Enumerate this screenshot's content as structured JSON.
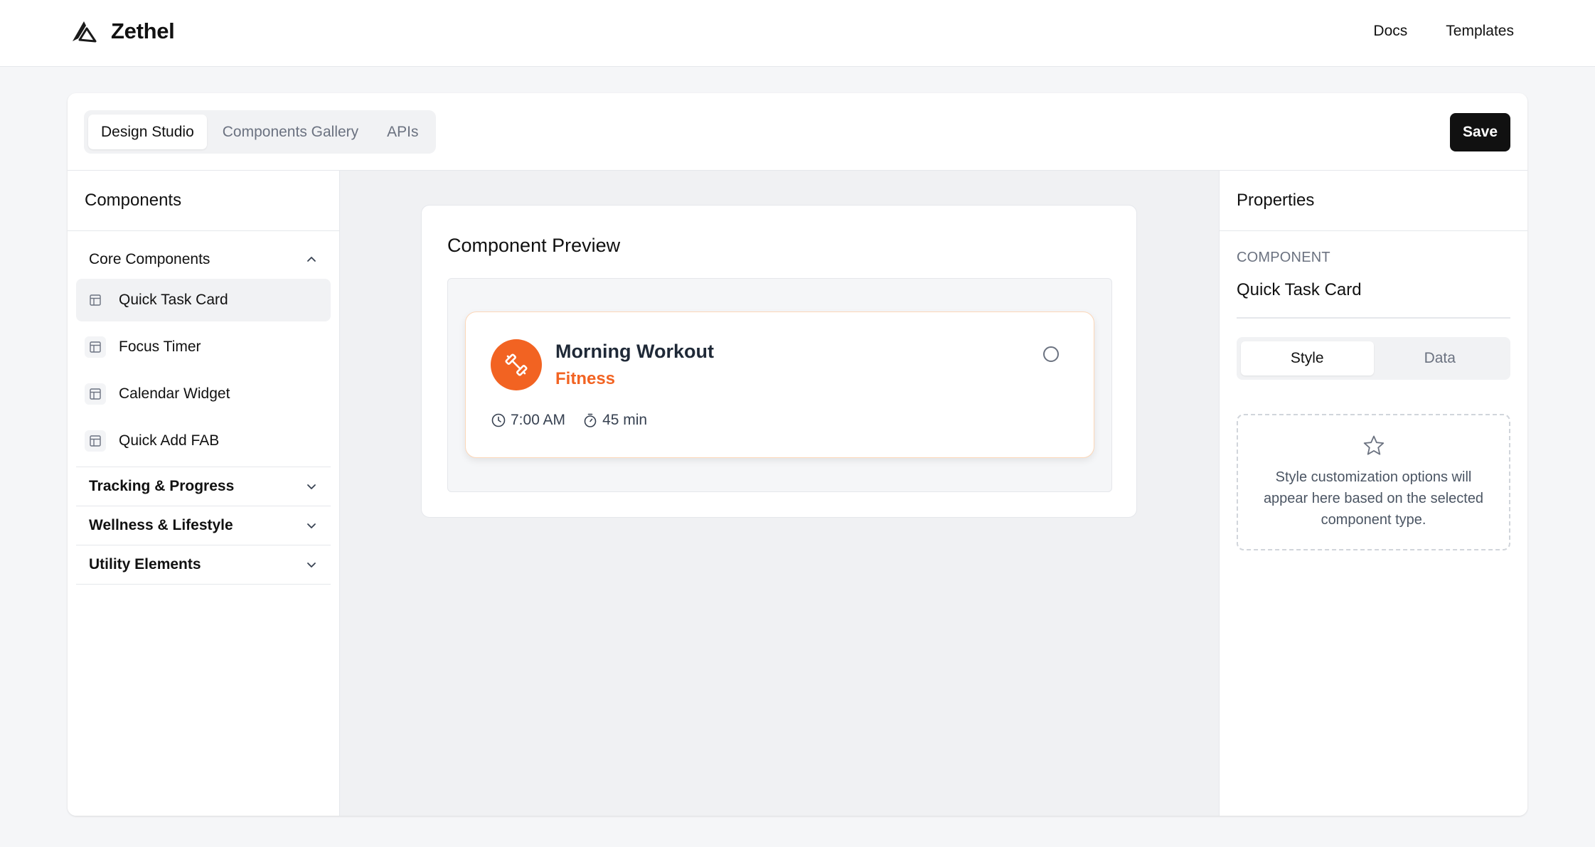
{
  "app": {
    "brand": "Zethel"
  },
  "nav": {
    "docs": "Docs",
    "templates": "Templates"
  },
  "tabs": [
    {
      "label": "Design Studio",
      "active": true
    },
    {
      "label": "Components Gallery",
      "active": false
    },
    {
      "label": "APIs",
      "active": false
    }
  ],
  "toolbar": {
    "save_label": "Save"
  },
  "sidebar": {
    "title": "Components",
    "groups": [
      {
        "label": "Core Components",
        "expanded": true,
        "items": [
          "Quick Task Card",
          "Focus Timer",
          "Calendar Widget",
          "Quick Add FAB"
        ],
        "selected": "Quick Task Card"
      },
      {
        "label": "Tracking & Progress",
        "expanded": false
      },
      {
        "label": "Wellness & Lifestyle",
        "expanded": false
      },
      {
        "label": "Utility Elements",
        "expanded": false
      }
    ]
  },
  "preview": {
    "title": "Component Preview",
    "card": {
      "title": "Morning Workout",
      "category": "Fitness",
      "time": "7:00 AM",
      "duration": "45 min",
      "accent_color": "#f26322",
      "icon": "dumbbell-icon"
    }
  },
  "properties": {
    "title": "Properties",
    "kicker": "COMPONENT",
    "component_name": "Quick Task Card",
    "segments": [
      {
        "label": "Style",
        "active": true
      },
      {
        "label": "Data",
        "active": false
      }
    ],
    "empty_text": "Style customization options will appear here based on the selected component type."
  }
}
